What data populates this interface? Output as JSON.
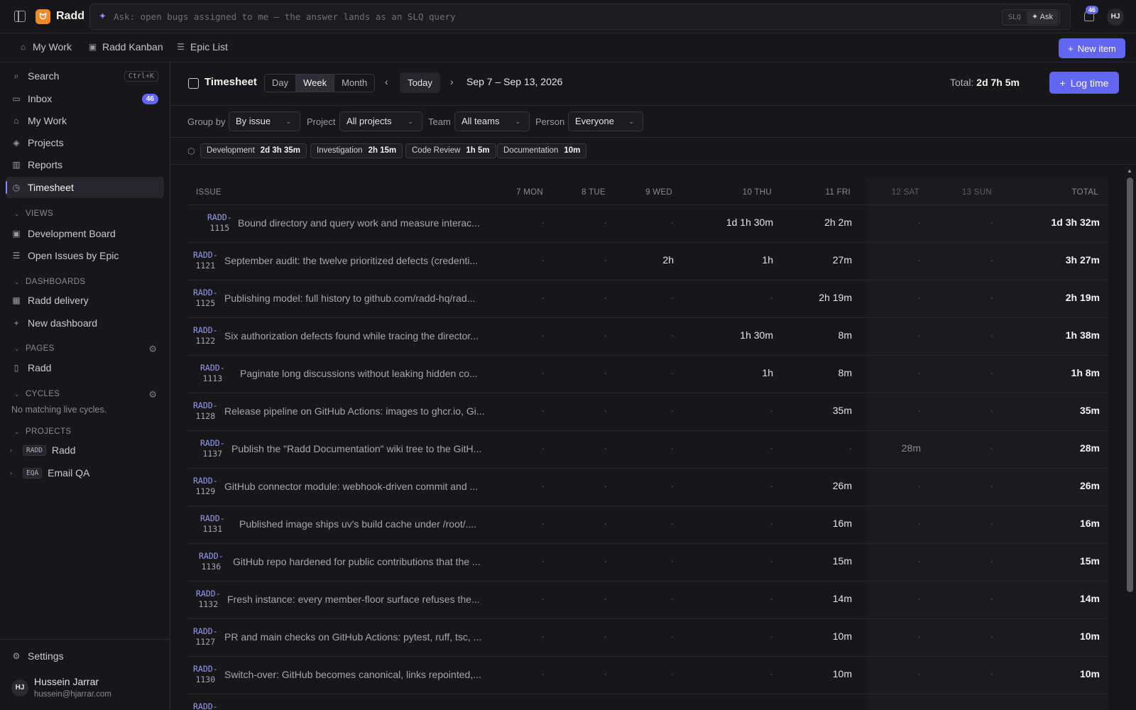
{
  "app": {
    "brand": "Radd",
    "logo_glyph": "ᗢ"
  },
  "topbar": {
    "ask_placeholder": "Ask: open bugs assigned to me — the answer lands as an SLQ query",
    "slq_label": "SLQ",
    "ask_label": "Ask",
    "notifications_count": "46",
    "user_initials": "HJ"
  },
  "navbar": {
    "tabs": [
      {
        "label": "My Work",
        "icon": "home-icon"
      },
      {
        "label": "Radd Kanban",
        "icon": "kanban-icon"
      },
      {
        "label": "Epic List",
        "icon": "list-icon"
      }
    ],
    "new_item_label": "New item"
  },
  "sidebar": {
    "items": [
      {
        "label": "Search",
        "icon": "search-icon",
        "shortcut": "Ctrl+K"
      },
      {
        "label": "Inbox",
        "icon": "inbox-icon",
        "badge": "46"
      },
      {
        "label": "My Work",
        "icon": "home-icon"
      },
      {
        "label": "Projects",
        "icon": "layers-icon"
      },
      {
        "label": "Reports",
        "icon": "chart-icon"
      },
      {
        "label": "Timesheet",
        "icon": "clock-icon"
      }
    ],
    "views_title": "VIEWS",
    "views": [
      {
        "label": "Development Board",
        "icon": "board-icon"
      },
      {
        "label": "Open Issues by Epic",
        "icon": "list-icon"
      }
    ],
    "dashboards_title": "DASHBOARDS",
    "dashboards": [
      {
        "label": "Radd delivery",
        "icon": "grid-icon"
      },
      {
        "label": "New dashboard",
        "icon": "plus-icon"
      }
    ],
    "pages_title": "PAGES",
    "pages": [
      {
        "label": "Radd",
        "icon": "book-icon"
      }
    ],
    "cycles_title": "CYCLES",
    "cycles_empty": "No matching live cycles.",
    "projects_title": "PROJECTS",
    "projects": [
      {
        "key": "RADD",
        "label": "Radd"
      },
      {
        "key": "EQA",
        "label": "Email QA"
      }
    ],
    "settings_label": "Settings",
    "user": {
      "initials": "HJ",
      "name": "Hussein Jarrar",
      "email": "hussein@hjarrar.com"
    }
  },
  "timesheet": {
    "title": "Timesheet",
    "views": [
      "Day",
      "Week",
      "Month"
    ],
    "active_view": "Week",
    "today_label": "Today",
    "range": "Sep 7 – Sep 13, 2026",
    "total_prefix": "Total:",
    "total_value": "2d 7h 5m",
    "log_time_label": "Log time"
  },
  "filters": {
    "group_by": {
      "label": "Group by",
      "value": "By issue"
    },
    "project": {
      "label": "Project",
      "value": "All projects"
    },
    "team": {
      "label": "Team",
      "value": "All teams"
    },
    "person": {
      "label": "Person",
      "value": "Everyone"
    }
  },
  "tags": [
    {
      "name": "Development",
      "value": "2d 3h 35m"
    },
    {
      "name": "Investigation",
      "value": "2h 15m"
    },
    {
      "name": "Code Review",
      "value": "1h 5m"
    },
    {
      "name": "Documentation",
      "value": "10m"
    }
  ],
  "table": {
    "columns": [
      "ISSUE",
      "7 MON",
      "8 TUE",
      "9 WED",
      "10 THU",
      "11 FRI",
      "12 SAT",
      "13 SUN",
      "TOTAL"
    ],
    "empty_mark": "·",
    "rows": [
      {
        "key": "RADD-",
        "num": "1115",
        "title": "Bound directory and query work and measure interac...",
        "cells": [
          "·",
          "·",
          "·",
          "1d 1h 30m",
          "2h 2m",
          "·",
          "·"
        ],
        "total": "1d 3h 32m"
      },
      {
        "key": "RADD-",
        "num": "1121",
        "title": "September audit: the twelve prioritized defects (credenti...",
        "cells": [
          "·",
          "·",
          "2h",
          "1h",
          "27m",
          "·",
          "·"
        ],
        "total": "3h 27m"
      },
      {
        "key": "RADD-",
        "num": "1125",
        "title": "Publishing model: full history to github.com/radd-hq/rad...",
        "cells": [
          "·",
          "·",
          "·",
          "·",
          "2h 19m",
          "·",
          "·"
        ],
        "total": "2h 19m"
      },
      {
        "key": "RADD-",
        "num": "1122",
        "title": "Six authorization defects found while tracing the director...",
        "cells": [
          "·",
          "·",
          "·",
          "1h 30m",
          "8m",
          "·",
          "·"
        ],
        "total": "1h 38m"
      },
      {
        "key": "RADD-",
        "num": "1113",
        "title": "Paginate long discussions without leaking hidden co...",
        "cells": [
          "·",
          "·",
          "·",
          "1h",
          "8m",
          "·",
          "·"
        ],
        "total": "1h 8m"
      },
      {
        "key": "RADD-",
        "num": "1128",
        "title": "Release pipeline on GitHub Actions: images to ghcr.io, Gi...",
        "cells": [
          "·",
          "·",
          "·",
          "·",
          "35m",
          "·",
          "·"
        ],
        "total": "35m"
      },
      {
        "key": "RADD-",
        "num": "1137",
        "title": "Publish the \"Radd Documentation\" wiki tree to the GitH...",
        "cells": [
          "·",
          "·",
          "·",
          "·",
          "·",
          "28m",
          "·"
        ],
        "total": "28m"
      },
      {
        "key": "RADD-",
        "num": "1129",
        "title": "GitHub connector module: webhook-driven commit and ...",
        "cells": [
          "·",
          "·",
          "·",
          "·",
          "26m",
          "·",
          "·"
        ],
        "total": "26m"
      },
      {
        "key": "RADD-",
        "num": "1131",
        "title": "Published image ships uv's build cache under /root/....",
        "cells": [
          "·",
          "·",
          "·",
          "·",
          "16m",
          "·",
          "·"
        ],
        "total": "16m"
      },
      {
        "key": "RADD-",
        "num": "1136",
        "title": "GitHub repo hardened for public contributions that the ...",
        "cells": [
          "·",
          "·",
          "·",
          "·",
          "15m",
          "·",
          "·"
        ],
        "total": "15m"
      },
      {
        "key": "RADD-",
        "num": "1132",
        "title": "Fresh instance: every member-floor surface refuses the...",
        "cells": [
          "·",
          "·",
          "·",
          "·",
          "14m",
          "·",
          "·"
        ],
        "total": "14m"
      },
      {
        "key": "RADD-",
        "num": "1127",
        "title": "PR and main checks on GitHub Actions: pytest, ruff, tsc, ...",
        "cells": [
          "·",
          "·",
          "·",
          "·",
          "10m",
          "·",
          "·"
        ],
        "total": "10m"
      },
      {
        "key": "RADD-",
        "num": "1130",
        "title": "Switch-over: GitHub becomes canonical, links repointed,...",
        "cells": [
          "·",
          "·",
          "·",
          "·",
          "10m",
          "·",
          "·"
        ],
        "total": "10m"
      },
      {
        "key": "RADD-",
        "num": "",
        "title": "",
        "cells": [
          "",
          "",
          "",
          "",
          "",
          "",
          ""
        ],
        "total": ""
      }
    ]
  },
  "colors": {
    "accent": "#6366f1",
    "background": "#17171a",
    "issue_key": "#9a9af5"
  }
}
